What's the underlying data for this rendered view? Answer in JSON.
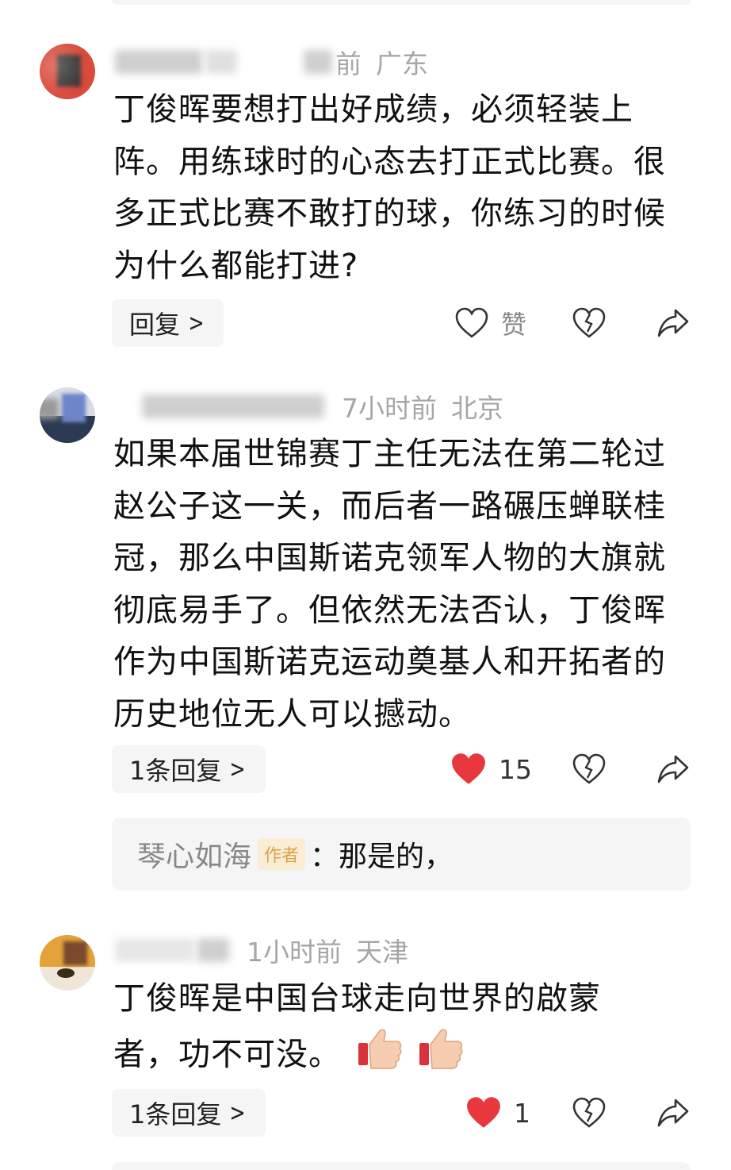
{
  "comments": [
    {
      "time": "前",
      "location": "广东",
      "text": "丁俊晖要想打出好成绩，必须轻装上阵。用练球时的心态去打正式比赛。很多正式比赛不敢打的球，你练习的时候为什么都能打进?",
      "reply_label": "回复",
      "like_label": "赞",
      "liked": false
    },
    {
      "time": "7小时前",
      "location": "北京",
      "text": "如果本届世锦赛丁主任无法在第二轮过赵公子这一关，而后者一路碾压蝉联桂冠，那么中国斯诺克领军人物的大旗就彻底易手了。但依然无法否认，丁俊晖作为中国斯诺克运动奠基人和开拓者的历史地位无人可以撼动。",
      "reply_label": "1条回复",
      "like_count": "15",
      "liked": true,
      "sub_reply": {
        "author": "琴心如海",
        "badge": "作者",
        "text": "：那是的，"
      }
    },
    {
      "time": "1小时前",
      "location": "天津",
      "text": "丁俊晖是中国台球走向世界的啟蒙者，功不可没。",
      "emojis": [
        "thumbs-up",
        "thumbs-up"
      ],
      "reply_label": "1条回复",
      "like_count": "1",
      "liked": true
    }
  ],
  "colors": {
    "like_red": "#e8383d",
    "muted": "#a6a6a6",
    "badge_bg": "#fbecd6",
    "badge_text": "#d8a44c"
  }
}
